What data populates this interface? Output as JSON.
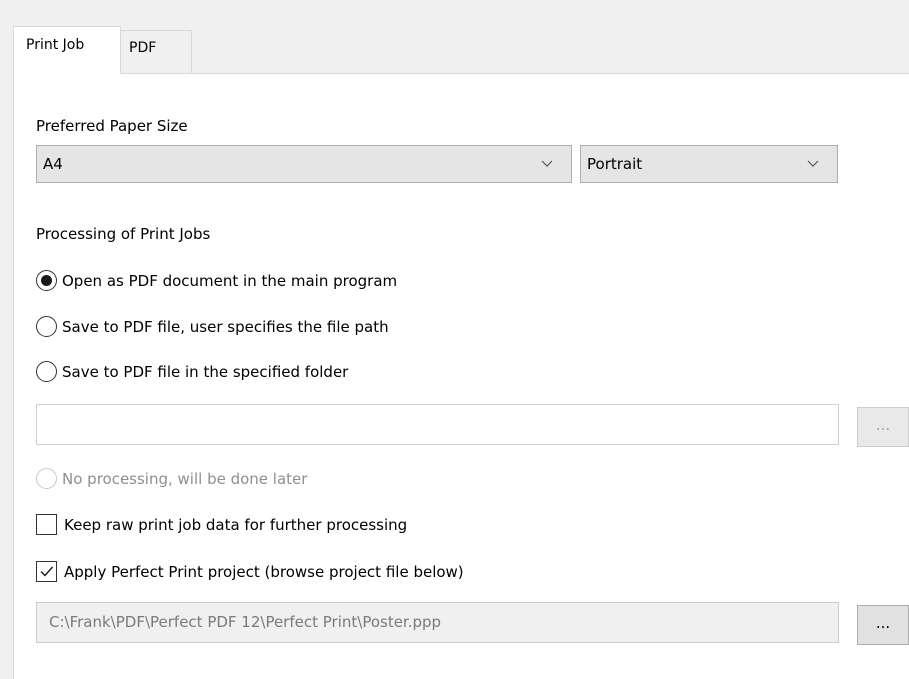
{
  "tabs": [
    {
      "label": "Print Job",
      "active": true
    },
    {
      "label": "PDF",
      "active": false
    }
  ],
  "paper": {
    "section_label": "Preferred Paper Size",
    "size_value": "A4",
    "orientation_value": "Portrait"
  },
  "processing": {
    "section_label": "Processing of Print Jobs",
    "options": [
      {
        "label": "Open as PDF document in the main program",
        "checked": true,
        "enabled": true
      },
      {
        "label": "Save to PDF file, user specifies the file path",
        "checked": false,
        "enabled": true
      },
      {
        "label": "Save to PDF file in the specified folder",
        "checked": false,
        "enabled": true
      },
      {
        "label": "No processing, will be done later",
        "checked": false,
        "enabled": false
      }
    ],
    "folder_path_value": "",
    "folder_browse_label": "..."
  },
  "options": {
    "keep_raw_label": "Keep raw print job data for further processing",
    "keep_raw_checked": false,
    "apply_project_label": "Apply Perfect Print project (browse project file below)",
    "apply_project_checked": true,
    "project_path_value": "C:\\Frank\\PDF\\Perfect PDF 12\\Perfect Print\\Poster.ppp",
    "project_browse_label": "..."
  },
  "icons": {
    "dropdown": "chevron-down-icon",
    "checkmark": "checkmark-icon"
  },
  "colors": {
    "panel_bg": "#ffffff",
    "window_bg": "#f0f0f0",
    "combo_bg": "#e5e5e5",
    "disabled_text": "#8f8f8f"
  }
}
